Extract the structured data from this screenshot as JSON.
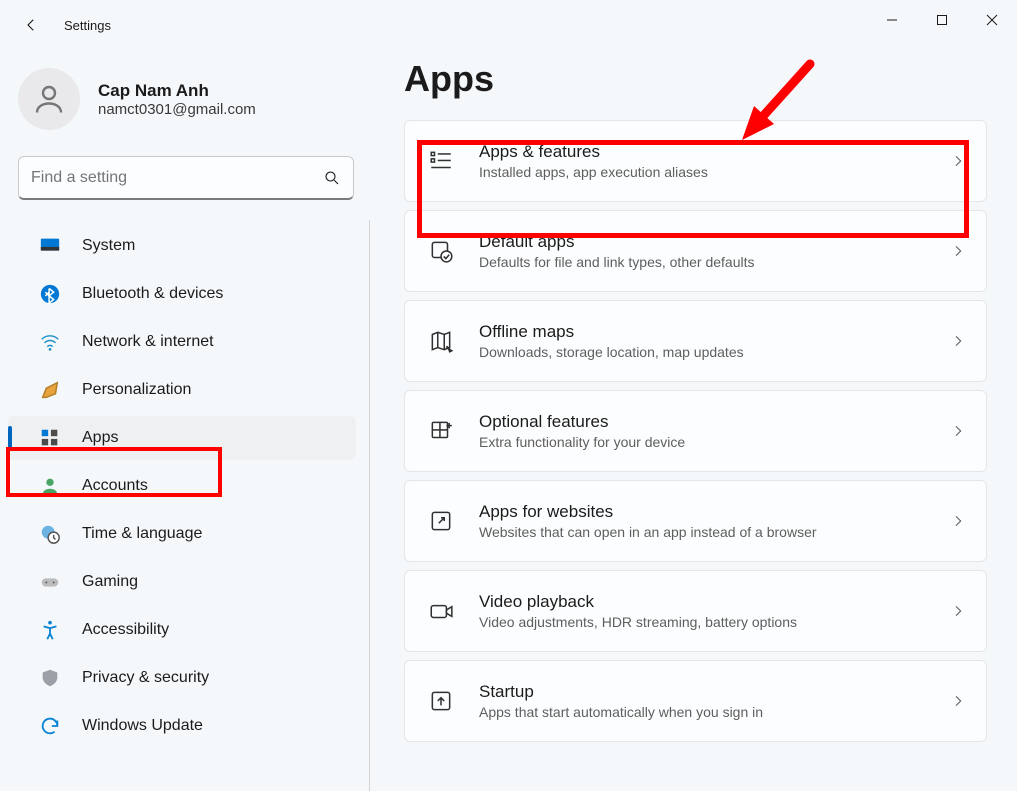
{
  "window": {
    "title": "Settings"
  },
  "user": {
    "name": "Cap Nam Anh",
    "email": "namct0301@gmail.com"
  },
  "search": {
    "placeholder": "Find a setting"
  },
  "nav": [
    {
      "id": "system",
      "label": "System",
      "icon": "monitor"
    },
    {
      "id": "bluetooth",
      "label": "Bluetooth & devices",
      "icon": "bluetooth"
    },
    {
      "id": "network",
      "label": "Network & internet",
      "icon": "wifi"
    },
    {
      "id": "personalization",
      "label": "Personalization",
      "icon": "brush"
    },
    {
      "id": "apps",
      "label": "Apps",
      "icon": "apps",
      "selected": true
    },
    {
      "id": "accounts",
      "label": "Accounts",
      "icon": "person"
    },
    {
      "id": "time",
      "label": "Time & language",
      "icon": "globe-clock"
    },
    {
      "id": "gaming",
      "label": "Gaming",
      "icon": "gamepad"
    },
    {
      "id": "accessibility",
      "label": "Accessibility",
      "icon": "accessibility"
    },
    {
      "id": "privacy",
      "label": "Privacy & security",
      "icon": "shield"
    },
    {
      "id": "update",
      "label": "Windows Update",
      "icon": "update"
    }
  ],
  "page": {
    "title": "Apps"
  },
  "cards": [
    {
      "id": "apps-features",
      "title": "Apps & features",
      "sub": "Installed apps, app execution aliases",
      "icon": "list"
    },
    {
      "id": "default-apps",
      "title": "Default apps",
      "sub": "Defaults for file and link types, other defaults",
      "icon": "default-app"
    },
    {
      "id": "offline-maps",
      "title": "Offline maps",
      "sub": "Downloads, storage location, map updates",
      "icon": "map"
    },
    {
      "id": "optional-features",
      "title": "Optional features",
      "sub": "Extra functionality for your device",
      "icon": "puzzle"
    },
    {
      "id": "apps-websites",
      "title": "Apps for websites",
      "sub": "Websites that can open in an app instead of a browser",
      "icon": "link-out"
    },
    {
      "id": "video-playback",
      "title": "Video playback",
      "sub": "Video adjustments, HDR streaming, battery options",
      "icon": "video"
    },
    {
      "id": "startup",
      "title": "Startup",
      "sub": "Apps that start automatically when you sign in",
      "icon": "startup"
    }
  ]
}
